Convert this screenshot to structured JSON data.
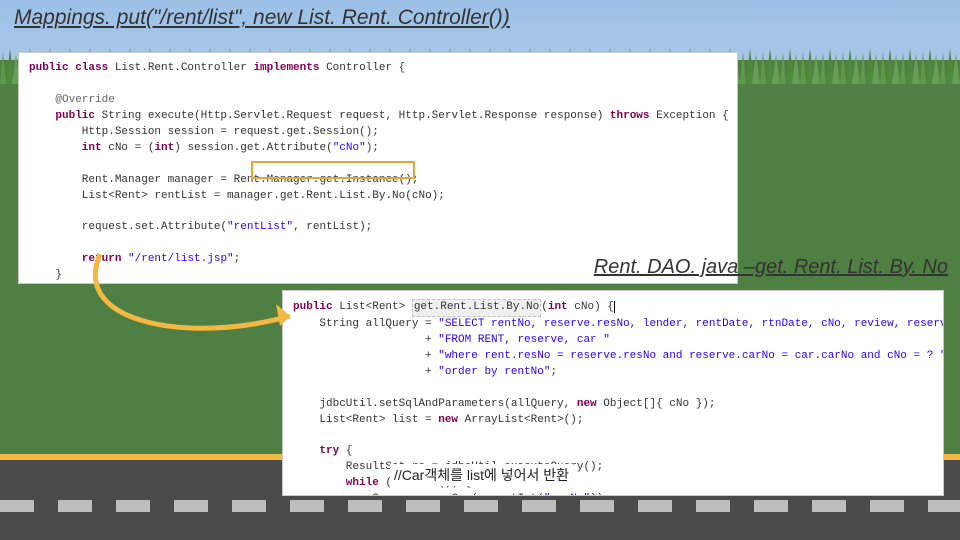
{
  "title": "Mappings. put(\"/rent/list\", new List. Rent. Controller())",
  "subtitle": "Rent. DAO. java –get. Rent. List. By. No",
  "note": "//Car객체를 list에 넣어서 반환",
  "code1": {
    "l1a": "public class",
    "l1b": " List.Rent.Controller ",
    "l1c": "implements",
    "l1d": " Controller {",
    "l2": "    @Override",
    "l3a": "    public",
    "l3b": " String execute(Http.Servlet.Request request, Http.Servlet.Response response) ",
    "l3c": "throws",
    "l3d": " Exception {",
    "l4": "        Http.Session session = request.get.Session();",
    "l5a": "        int",
    "l5b": " cNo = (",
    "l5c": "int",
    "l5d": ") session.get.Attribute(",
    "l5e": "\"cNo\"",
    "l5f": ");",
    "l6": "",
    "l7": "        Rent.Manager manager = Rent.Manager.get.Instance();",
    "l8": "        List<Rent> rentList = manager.get.Rent.List.By.No(cNo);",
    "l9": "",
    "l10a": "        request.set.Attribute(",
    "l10b": "\"rentList\"",
    "l10c": ", rentList);",
    "l11": "",
    "l12a": "        return ",
    "l12b": "\"/rent/list.jsp\"",
    "l12c": ";",
    "l13": "    }"
  },
  "code2": {
    "l1a": "public",
    "l1b": " List<Rent> ",
    "l1name": "get.Rent.List.By.No",
    "l1c": "(",
    "l1d": "int",
    "l1e": " cNo) {",
    "l2a": "    String allQuery = ",
    "l2b": "\"SELECT rentNo, reserve.resNo, lender, rentDate, rtnDate, cNo, review, reserve.carNo \"",
    "l3a": "                    + ",
    "l3b": "\"FROM RENT, reserve, car \"",
    "l4a": "                    + ",
    "l4b": "\"where rent.resNo = reserve.resNo and reserve.carNo = car.carNo and cNo = ? \"",
    "l5a": "                    + ",
    "l5b": "\"order by rentNo\"",
    "l5c": ";",
    "l6": "",
    "l7a": "    jdbcUtil.setSqlAndParameters(allQuery, ",
    "l7b": "new",
    "l7c": " Object[]{ cNo });",
    "l8a": "    List<Rent> list = ",
    "l8b": "new",
    "l8c": " ArrayList<Rent>();",
    "l9": "",
    "l10a": "    try",
    "l10b": " {",
    "l11": "        ResultSet rs = jdbcUtil.executeQuery();",
    "l12a": "        while",
    "l12b": " (rs.next()) {",
    "l13a": "            Car c = ",
    "l13b": "new",
    "l13c": " Car(rs.getInt(",
    "l13d": "\"carNo\"",
    "l13e": "));"
  }
}
